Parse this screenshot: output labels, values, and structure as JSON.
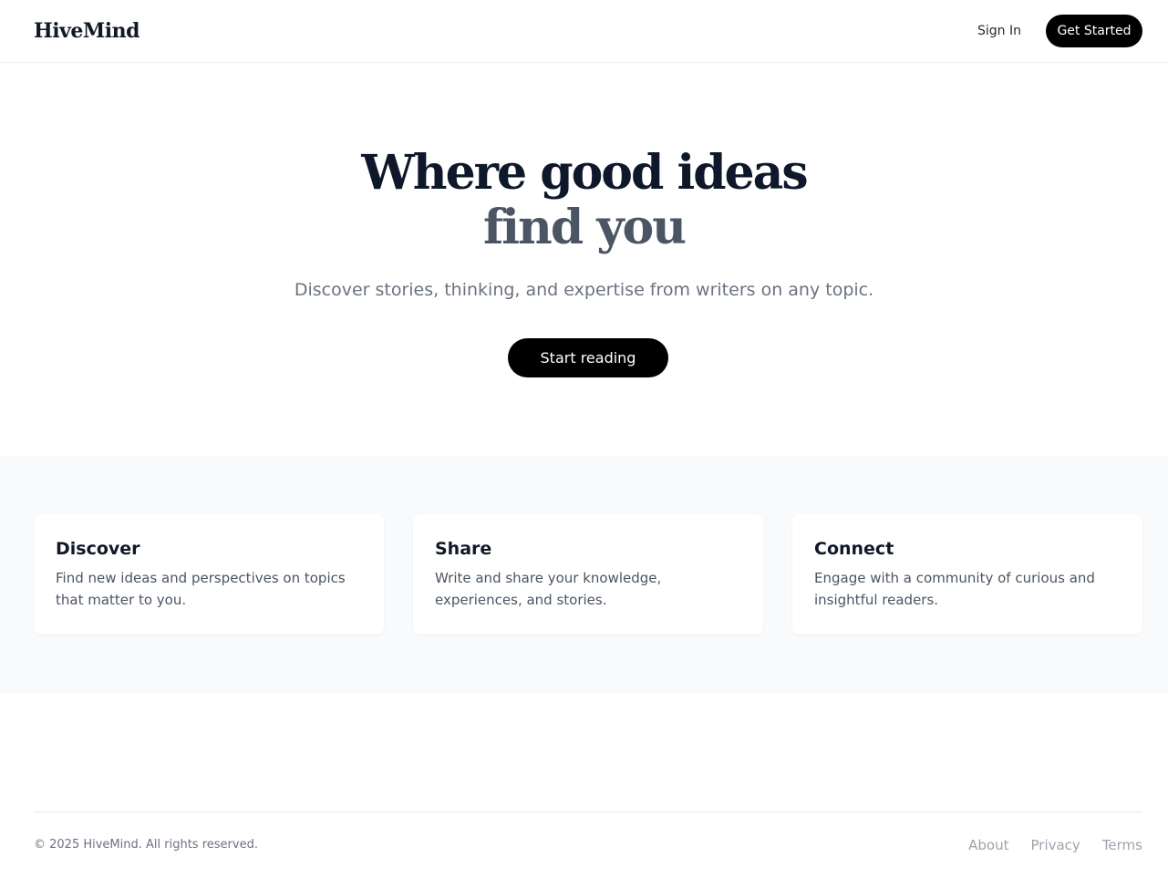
{
  "header": {
    "logo": "HiveMind",
    "sign_in": "Sign In",
    "get_started": "Get Started"
  },
  "hero": {
    "title_line1": "Where good ideas",
    "title_line2": "find you",
    "subtitle": "Discover stories, thinking, and expertise from writers on any topic.",
    "cta": "Start reading"
  },
  "features": [
    {
      "title": "Discover",
      "text": "Find new ideas and perspectives on topics that matter to you."
    },
    {
      "title": "Share",
      "text": "Write and share your knowledge, experiences, and stories."
    },
    {
      "title": "Connect",
      "text": "Engage with a community of curious and insightful readers."
    }
  ],
  "footer": {
    "copyright": "© 2025 HiveMind. All rights reserved.",
    "links": [
      "About",
      "Privacy",
      "Terms"
    ]
  },
  "colors": {
    "primary_button": "#000000",
    "heading": "#0f172a",
    "heading_secondary": "#4b5563",
    "muted_text": "#6b7280",
    "section_bg": "#f9fafb"
  }
}
